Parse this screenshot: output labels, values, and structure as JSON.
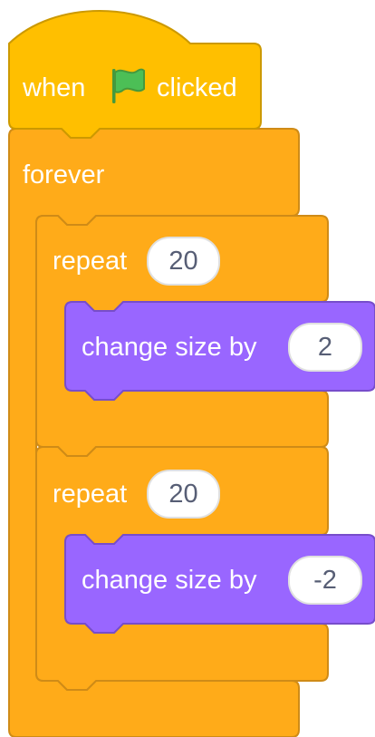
{
  "colors": {
    "events": "#FFBF00",
    "events_border": "#CC9900",
    "control": "#FFAB19",
    "control_border": "#CF8B17",
    "looks": "#9966FF",
    "looks_border": "#774DCB",
    "flag": "#4CBF56",
    "flag_border": "#45993D",
    "input_text": "#575E75"
  },
  "hat_block": {
    "when_label": "when",
    "flag_icon": "green-flag-icon",
    "clicked_label": "clicked"
  },
  "forever_block": {
    "label": "forever"
  },
  "repeat_blocks": [
    {
      "label": "repeat",
      "count": "20",
      "inner": {
        "label": "change size by",
        "value": "2"
      }
    },
    {
      "label": "repeat",
      "count": "20",
      "inner": {
        "label": "change size by",
        "value": "-2"
      }
    }
  ]
}
